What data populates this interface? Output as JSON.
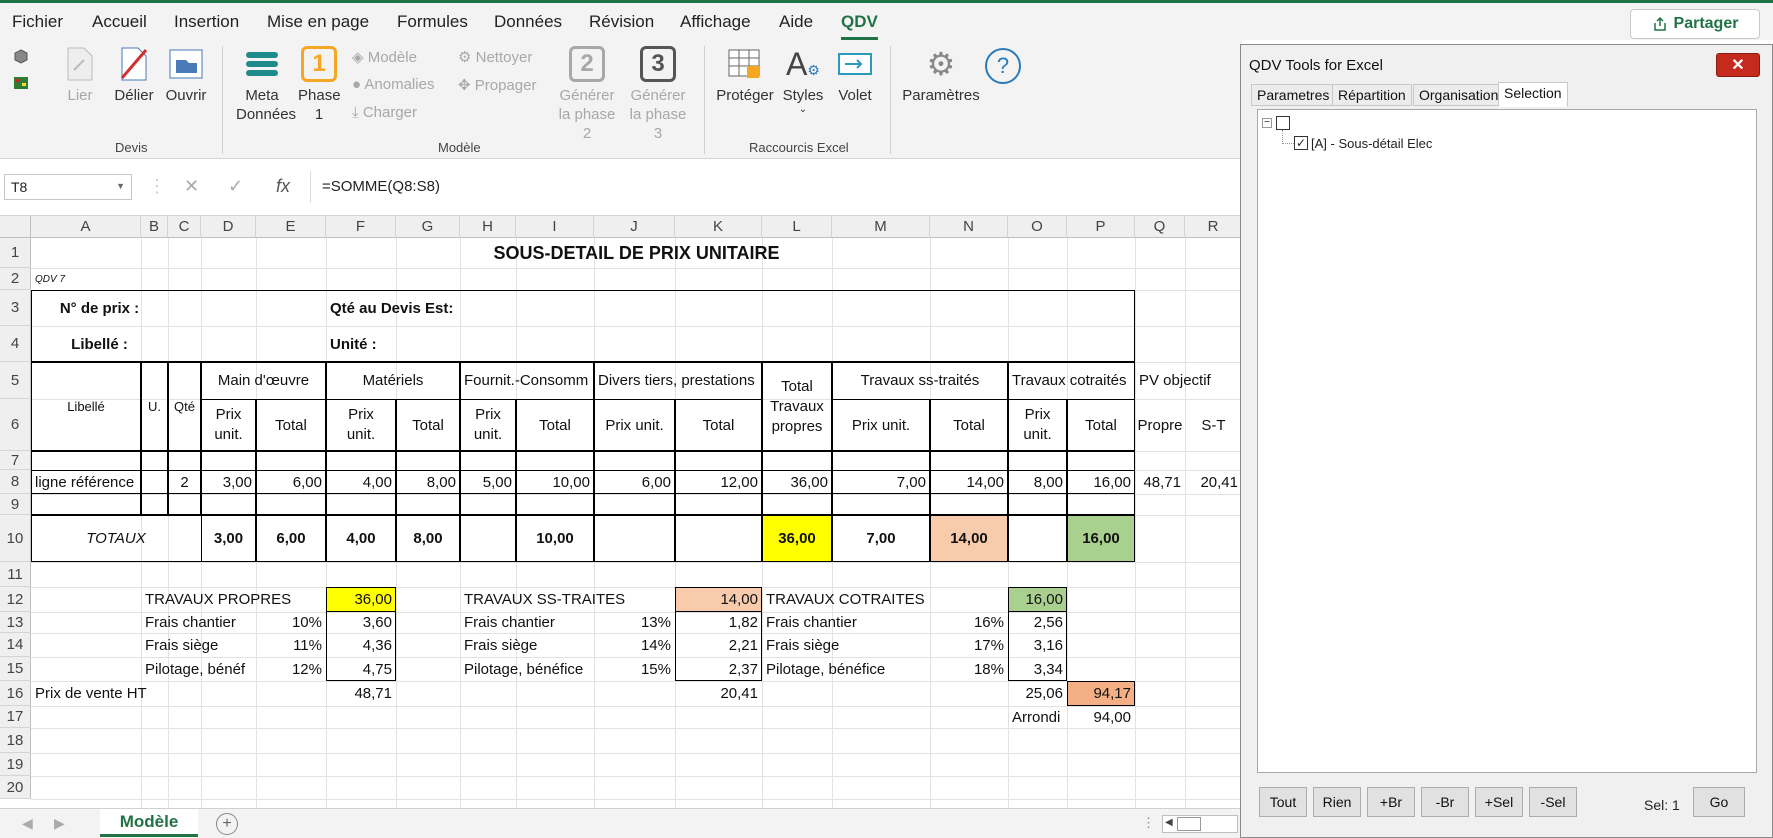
{
  "menu": {
    "items": [
      "Fichier",
      "Accueil",
      "Insertion",
      "Mise en page",
      "Formules",
      "Données",
      "Révision",
      "Affichage",
      "Aide",
      "QDV"
    ],
    "share_label": "Partager"
  },
  "ribbon": {
    "lier": "Lier",
    "delier": "Délier",
    "ouvrir": "Ouvrir",
    "devis_group": "Devis",
    "meta_line1": "Meta",
    "meta_line2": "Données",
    "phase1_num": "1",
    "phase1_line1": "Phase",
    "phase1_line2": "1",
    "modele": "Modèle",
    "anomalies": "Anomalies",
    "charger": "Charger",
    "nettoyer": "Nettoyer",
    "propager": "Propager",
    "gen2_num": "2",
    "gen2_line1": "Générer",
    "gen2_line2": "la phase 2",
    "gen3_num": "3",
    "gen3_line1": "Générer",
    "gen3_line2": "la phase 3",
    "modele_group": "Modèle",
    "proteger": "Protéger",
    "styles": "Styles",
    "volet": "Volet",
    "raccourcis_group": "Raccourcis Excel",
    "parametres": "Paramètres"
  },
  "formula_bar": {
    "name_box": "T8",
    "fx": "fx",
    "formula": "=SOMME(Q8:S8)"
  },
  "columns": [
    "A",
    "B",
    "C",
    "D",
    "E",
    "F",
    "G",
    "H",
    "I",
    "J",
    "K",
    "L",
    "M",
    "N",
    "O",
    "P",
    "Q",
    "R"
  ],
  "rows": [
    "1",
    "2",
    "3",
    "4",
    "5",
    "6",
    "7",
    "8",
    "9",
    "10",
    "11",
    "12",
    "13",
    "14",
    "15",
    "16",
    "17",
    "18",
    "19",
    "20"
  ],
  "sheet": {
    "title": "SOUS-DETAIL DE PRIX UNITAIRE",
    "qdv_tag": "QDV 7",
    "no_prix": "N° de prix :",
    "libelle_label": "Libellé :",
    "qte_devis": "Qté au Devis Est:",
    "unite": "Unité :",
    "h_libelle": "Libellé",
    "h_u": "U.",
    "h_qte": "Qté",
    "h_main": "Main d'œuvre",
    "h_materiels": "Matériels",
    "h_fournit": "Fournit.-Consomm",
    "h_divers": "Divers tiers, prestations",
    "h_total_tp1": "Total",
    "h_total_tp2": "Travaux",
    "h_total_tp3": "propres",
    "h_sstraites": "Travaux ss-traités",
    "h_cotraites": "Travaux cotraités",
    "h_pv": "PV objectif",
    "h_prix_unit": "Prix unit.",
    "h_prix": "Prix",
    "h_unit": "unit.",
    "h_total": "Total",
    "h_propre": "Propre",
    "h_st": "S-T",
    "row8": {
      "libelle": "ligne référence",
      "qte": "2",
      "mo_pu": "3,00",
      "mo_t": "6,00",
      "mat_pu": "4,00",
      "mat_t": "8,00",
      "fc_pu": "5,00",
      "fc_t": "10,00",
      "div_pu": "6,00",
      "div_t": "12,00",
      "tp": "36,00",
      "st_pu": "7,00",
      "st_t": "14,00",
      "ct_pu": "8,00",
      "ct_t": "16,00",
      "pv_propre": "48,71",
      "pv_st": "20,41"
    },
    "totaux": {
      "label": "TOTAUX",
      "mo_pu": "3,00",
      "mo_t": "6,00",
      "mat_pu": "4,00",
      "mat_t": "8,00",
      "fc_t": "10,00",
      "tp": "36,00",
      "st_pu": "7,00",
      "st_t": "14,00",
      "ct_t": "16,00"
    },
    "summary": {
      "tp_label": "TRAVAUX PROPRES",
      "tp_val": "36,00",
      "st_label": "TRAVAUX SS-TRAITES",
      "st_val": "14,00",
      "ct_label": "TRAVAUX COTRAITES",
      "ct_val": "16,00",
      "frais_chantier": "Frais chantier",
      "frais_siege": "Frais siège",
      "pilotage1": "Pilotage, bénéf",
      "pilotage2": "Pilotage, bénéfice",
      "pilotage3": "Pilotage, bénéfice",
      "tp_fc_pct": "10%",
      "tp_fc_val": "3,60",
      "tp_fs_pct": "11%",
      "tp_fs_val": "4,36",
      "tp_pil_pct": "12%",
      "tp_pil_val": "4,75",
      "st_fc_pct": "13%",
      "st_fc_val": "1,82",
      "st_fs_pct": "14%",
      "st_fs_val": "2,21",
      "st_pil_pct": "15%",
      "st_pil_val": "2,37",
      "ct_fc_pct": "16%",
      "ct_fc_val": "2,56",
      "ct_fs_pct": "17%",
      "ct_fs_val": "3,16",
      "ct_pil_pct": "18%",
      "ct_pil_val": "3,34",
      "pv_label": "Prix de vente HT",
      "pv_tp": "48,71",
      "pv_st": "20,41",
      "pv_ct": "25,06",
      "pv_total": "94,17",
      "arrondi_label": "Arrondi",
      "arrondi_val": "94,00"
    }
  },
  "sheet_tab": "Modèle",
  "panel": {
    "title": "QDV Tools for Excel",
    "tabs": [
      "Parametres",
      "Répartition",
      "Organisation",
      "Selection"
    ],
    "active_tab": "Selection",
    "tree_item": "[A] - Sous-détail Elec",
    "buttons": [
      "Tout",
      "Rien",
      "+Br",
      "-Br",
      "+Sel",
      "-Sel"
    ],
    "sel_label": "Sel: 1",
    "go": "Go"
  },
  "colors": {
    "excel_green": "#217346",
    "yellow": "#ffff00",
    "salmon": "#f8cbad",
    "green_fill": "#a9d08e",
    "orange_fill": "#f4b084",
    "close_red": "#c42b1c"
  }
}
